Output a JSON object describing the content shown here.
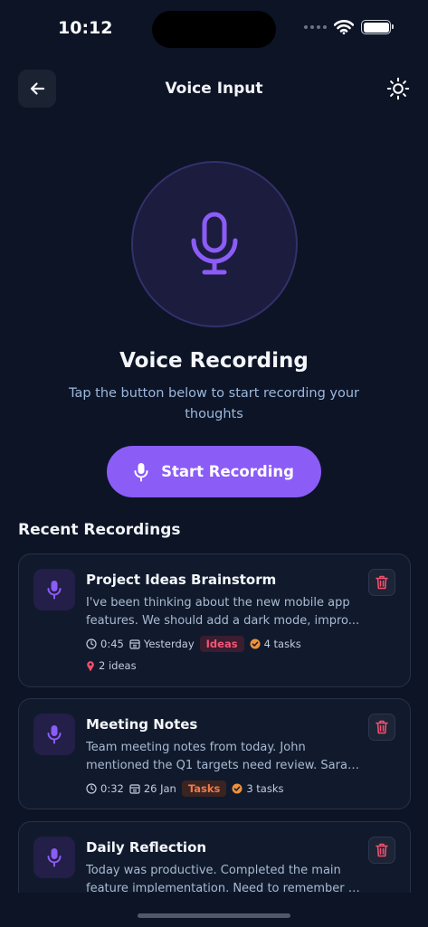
{
  "status": {
    "time": "10:12"
  },
  "header": {
    "title": "Voice Input"
  },
  "hero": {
    "title": "Voice Recording",
    "subtitle_line1": "Tap the button below to start recording your",
    "subtitle_line2": "thoughts",
    "button_label": "Start Recording"
  },
  "recent": {
    "title": "Recent Recordings",
    "items": [
      {
        "title": "Project Ideas Brainstorm",
        "line1": "I've been thinking about the new mobile app",
        "line2": "features. We should add a dark mode, impro...",
        "duration": "0:45",
        "date": "Yesterday",
        "tag": "Ideas",
        "tasks": "4 tasks",
        "ideas": "2 ideas"
      },
      {
        "title": "Meeting Notes",
        "line1": "Team meeting notes from today. John",
        "line2": "mentioned the Q1 targets need review. Sarah...",
        "duration": "0:32",
        "date": "26 Jan",
        "tag": "Tasks",
        "tasks": "3 tasks"
      },
      {
        "title": "Daily Reflection",
        "line1": "Today was productive. Completed the main",
        "line2": "feature implementation. Need to remember t..."
      }
    ]
  },
  "colors": {
    "background": "#0c1426",
    "accent": "#8b5cf6",
    "delete": "#f0506e",
    "ideas_tag": "#f2557a",
    "tasks_tag": "#f07a4a"
  }
}
